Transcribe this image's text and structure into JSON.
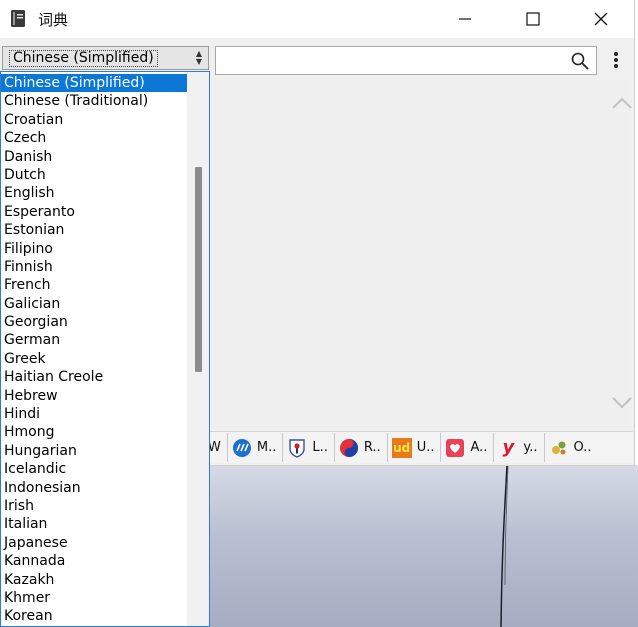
{
  "window": {
    "title": "词典",
    "icons": {
      "app": "book-icon",
      "minimize": "minimize-icon",
      "maximize": "maximize-icon",
      "close": "close-icon"
    }
  },
  "language_combo": {
    "selected": "Chinese (Simplified)",
    "options": [
      "Chinese (Simplified)",
      "Chinese (Traditional)",
      "Croatian",
      "Czech",
      "Danish",
      "Dutch",
      "English",
      "Esperanto",
      "Estonian",
      "Filipino",
      "Finnish",
      "French",
      "Galician",
      "Georgian",
      "German",
      "Greek",
      "Haitian Creole",
      "Hebrew",
      "Hindi",
      "Hmong",
      "Hungarian",
      "Icelandic",
      "Indonesian",
      "Irish",
      "Italian",
      "Japanese",
      "Kannada",
      "Kazakh",
      "Khmer",
      "Korean"
    ]
  },
  "search": {
    "value": "",
    "placeholder": "",
    "icon": "search-icon"
  },
  "menu": {
    "icon": "more-vertical-icon"
  },
  "dictionaries": [
    {
      "label": "W",
      "icon": ""
    },
    {
      "label": "M..",
      "icon": "globe-icon"
    },
    {
      "label": "L..",
      "icon": "shield-icon"
    },
    {
      "label": "R..",
      "icon": "swirl-icon"
    },
    {
      "label": "U..",
      "icon": "ud-icon"
    },
    {
      "label": "A..",
      "icon": "heart-box-icon"
    },
    {
      "label": "y..",
      "icon": "y-icon"
    },
    {
      "label": "O..",
      "icon": "dots-icon"
    }
  ],
  "colors": {
    "accent": "#0b78d7",
    "selected_text": "#ffffff"
  }
}
